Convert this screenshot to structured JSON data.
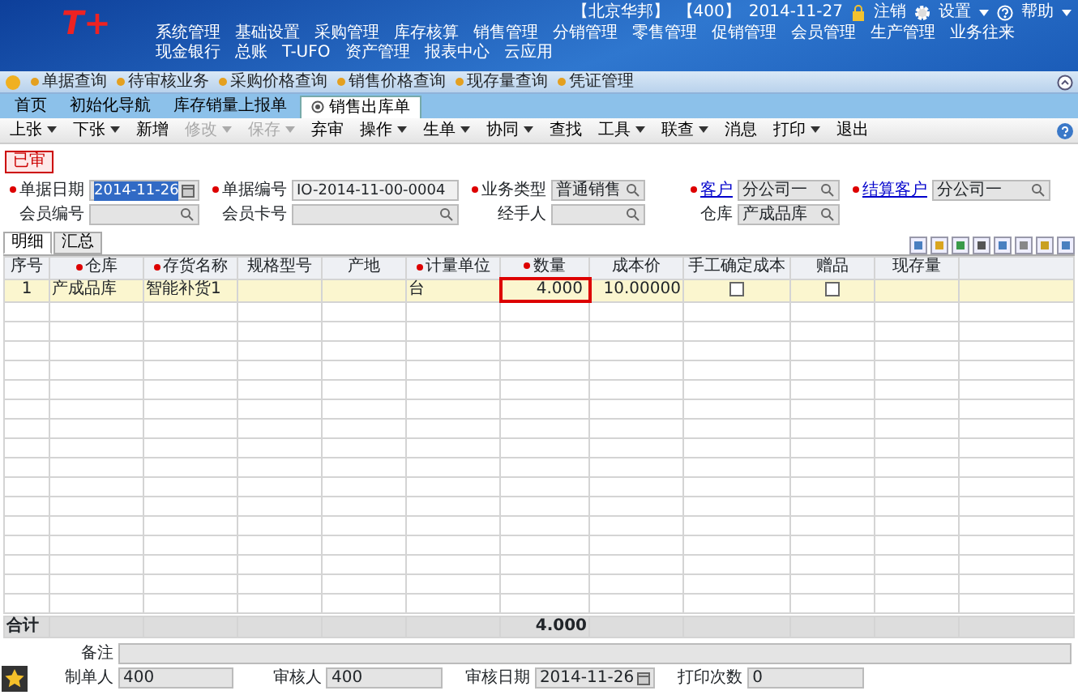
{
  "header": {
    "logo": "T+",
    "company": "【北京华邦】",
    "account": "【400】",
    "date": "2014-11-27",
    "logout": "注销",
    "settings": "设置",
    "help": "帮助"
  },
  "menu": [
    "系统管理",
    "基础设置",
    "采购管理",
    "库存核算",
    "销售管理",
    "分销管理",
    "零售管理",
    "促销管理",
    "会员管理",
    "生产管理",
    "业务往来",
    "现金银行",
    "总账",
    "T-UFO",
    "资产管理",
    "报表中心",
    "云应用"
  ],
  "quick_links": [
    "单据查询",
    "待审核业务",
    "采购价格查询",
    "销售价格查询",
    "现存量查询",
    "凭证管理"
  ],
  "tabs": [
    {
      "label": "首页",
      "selected": false
    },
    {
      "label": "初始化导航",
      "selected": false
    },
    {
      "label": "库存销量上报单",
      "selected": false
    },
    {
      "label": "销售出库单",
      "selected": true
    }
  ],
  "toolbar": [
    {
      "label": "上张",
      "dropdown": true,
      "disabled": false
    },
    {
      "label": "下张",
      "dropdown": true,
      "disabled": false
    },
    {
      "label": "新增",
      "dropdown": false,
      "disabled": false
    },
    {
      "label": "修改",
      "dropdown": true,
      "disabled": true
    },
    {
      "label": "保存",
      "dropdown": true,
      "disabled": true
    },
    {
      "label": "弃审",
      "dropdown": false,
      "disabled": false
    },
    {
      "label": "操作",
      "dropdown": true,
      "disabled": false
    },
    {
      "label": "生单",
      "dropdown": true,
      "disabled": false
    },
    {
      "label": "协同",
      "dropdown": true,
      "disabled": false
    },
    {
      "label": "查找",
      "dropdown": false,
      "disabled": false
    },
    {
      "label": "工具",
      "dropdown": true,
      "disabled": false
    },
    {
      "label": "联查",
      "dropdown": true,
      "disabled": false
    },
    {
      "label": "消息",
      "dropdown": false,
      "disabled": false
    },
    {
      "label": "打印",
      "dropdown": true,
      "disabled": false
    },
    {
      "label": "退出",
      "dropdown": false,
      "disabled": false
    }
  ],
  "status": "已审",
  "field_rows": [
    [
      {
        "label": "单据日期",
        "required": true,
        "link": false,
        "kind": "date",
        "value": "2014-11-26"
      },
      {
        "label": "单据编号",
        "required": true,
        "link": false,
        "kind": "text",
        "value": "IO-2014-11-00-0004"
      },
      {
        "label": "业务类型",
        "required": true,
        "link": false,
        "kind": "select",
        "value": "普通销售"
      },
      {
        "label": "客户",
        "required": true,
        "link": true,
        "kind": "lookup",
        "value": "分公司一"
      },
      {
        "label": "结算客户",
        "required": true,
        "link": true,
        "kind": "lookup",
        "value": "分公司一"
      }
    ],
    [
      {
        "label": "会员编号",
        "required": false,
        "link": false,
        "kind": "lookup"
      },
      {
        "label": "会员卡号",
        "required": false,
        "link": false,
        "kind": "lookup"
      },
      {
        "label": "经手人",
        "required": false,
        "link": false,
        "kind": "lookup"
      },
      {
        "label": "仓库",
        "required": false,
        "link": false,
        "kind": "lookup",
        "value": "产成品库"
      }
    ]
  ],
  "detail_tabs": [
    {
      "label": "明细",
      "selected": true
    },
    {
      "label": "汇总",
      "selected": false
    }
  ],
  "grid": {
    "columns": [
      {
        "label": "序号",
        "required": false,
        "kind": "text",
        "focused": false
      },
      {
        "label": "仓库",
        "required": true,
        "kind": "text",
        "focused": false
      },
      {
        "label": "存货名称",
        "required": true,
        "kind": "text",
        "focused": false
      },
      {
        "label": "规格型号",
        "required": false,
        "kind": "text",
        "focused": false
      },
      {
        "label": "产地",
        "required": false,
        "kind": "text",
        "focused": false
      },
      {
        "label": "计量单位",
        "required": true,
        "kind": "text",
        "focused": false
      },
      {
        "label": "数量",
        "required": true,
        "kind": "number",
        "focused": true
      },
      {
        "label": "成本价",
        "required": false,
        "kind": "number",
        "focused": false
      },
      {
        "label": "手工确定成本",
        "required": false,
        "kind": "check",
        "focused": false
      },
      {
        "label": "赠品",
        "required": false,
        "kind": "check",
        "focused": false
      },
      {
        "label": "现存量",
        "required": false,
        "kind": "text",
        "focused": false
      }
    ],
    "rows": [
      {
        "cells": [
          "1",
          "产成品库",
          "智能补货1",
          "",
          "",
          "台",
          "4.000",
          "10.00000",
          false,
          false,
          ""
        ]
      }
    ],
    "total_label": "合计",
    "total_quantity": "4.000"
  },
  "footer": [
    {
      "label": "备注",
      "kind": "wide"
    },
    {
      "label": "制单人",
      "kind": "text",
      "value": "400"
    },
    {
      "label": "审核人",
      "kind": "text",
      "value": "400"
    },
    {
      "label": "审核日期",
      "kind": "date",
      "value": "2014-11-26"
    },
    {
      "label": "打印次数",
      "kind": "text",
      "value": "0"
    }
  ]
}
